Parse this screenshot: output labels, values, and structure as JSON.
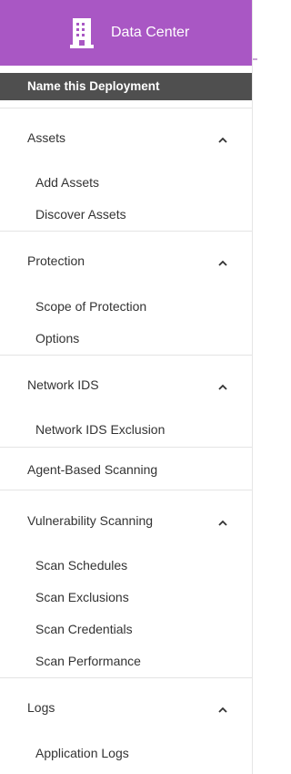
{
  "header": {
    "title": "Data Center",
    "icon": "building-icon",
    "background": "#a957c4"
  },
  "deploy_bar": {
    "label": "Name this Deployment",
    "background": "#4f4f4f"
  },
  "sections": {
    "assets": {
      "title": "Assets",
      "expanded": true,
      "items": [
        "Add Assets",
        "Discover Assets"
      ]
    },
    "protection": {
      "title": "Protection",
      "expanded": true,
      "items": [
        "Scope of Protection",
        "Options"
      ]
    },
    "network_ids": {
      "title": "Network IDS",
      "expanded": true,
      "items": [
        "Network IDS Exclusion"
      ]
    },
    "agent_scanning": {
      "title": "Agent-Based Scanning"
    },
    "vuln_scanning": {
      "title": "Vulnerability Scanning",
      "expanded": true,
      "items": [
        "Scan Schedules",
        "Scan Exclusions",
        "Scan Credentials",
        "Scan Performance"
      ]
    },
    "logs": {
      "title": "Logs",
      "expanded": true,
      "items": [
        "Application Logs"
      ]
    }
  }
}
